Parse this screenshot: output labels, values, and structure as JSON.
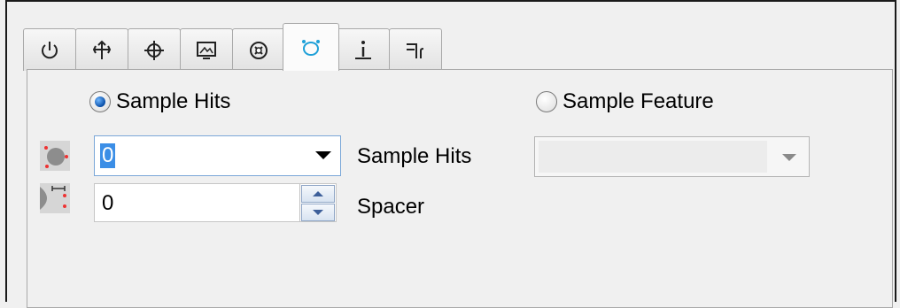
{
  "tabs": [
    {
      "icon": "power-icon",
      "active": false
    },
    {
      "icon": "move-arrows-icon",
      "active": false
    },
    {
      "icon": "crosshair-icon",
      "active": false
    },
    {
      "icon": "image-icon",
      "active": false
    },
    {
      "icon": "target-circle-icon",
      "active": false
    },
    {
      "icon": "sample-points-icon",
      "active": true
    },
    {
      "icon": "info-icon",
      "active": false
    },
    {
      "icon": "fork-icon",
      "active": false
    }
  ],
  "sampling": {
    "sample_hits_radio": "Sample Hits",
    "sample_feature_radio": "Sample Feature",
    "selected": "Sample Hits",
    "hits_combo_value": "0",
    "hits_label": "Sample Hits",
    "spacer_value": "0",
    "spacer_label": "Spacer",
    "feature_combo_value": ""
  },
  "colors": {
    "accent": "#3b8ee6",
    "active_tab_icon": "#1fa0d8"
  }
}
